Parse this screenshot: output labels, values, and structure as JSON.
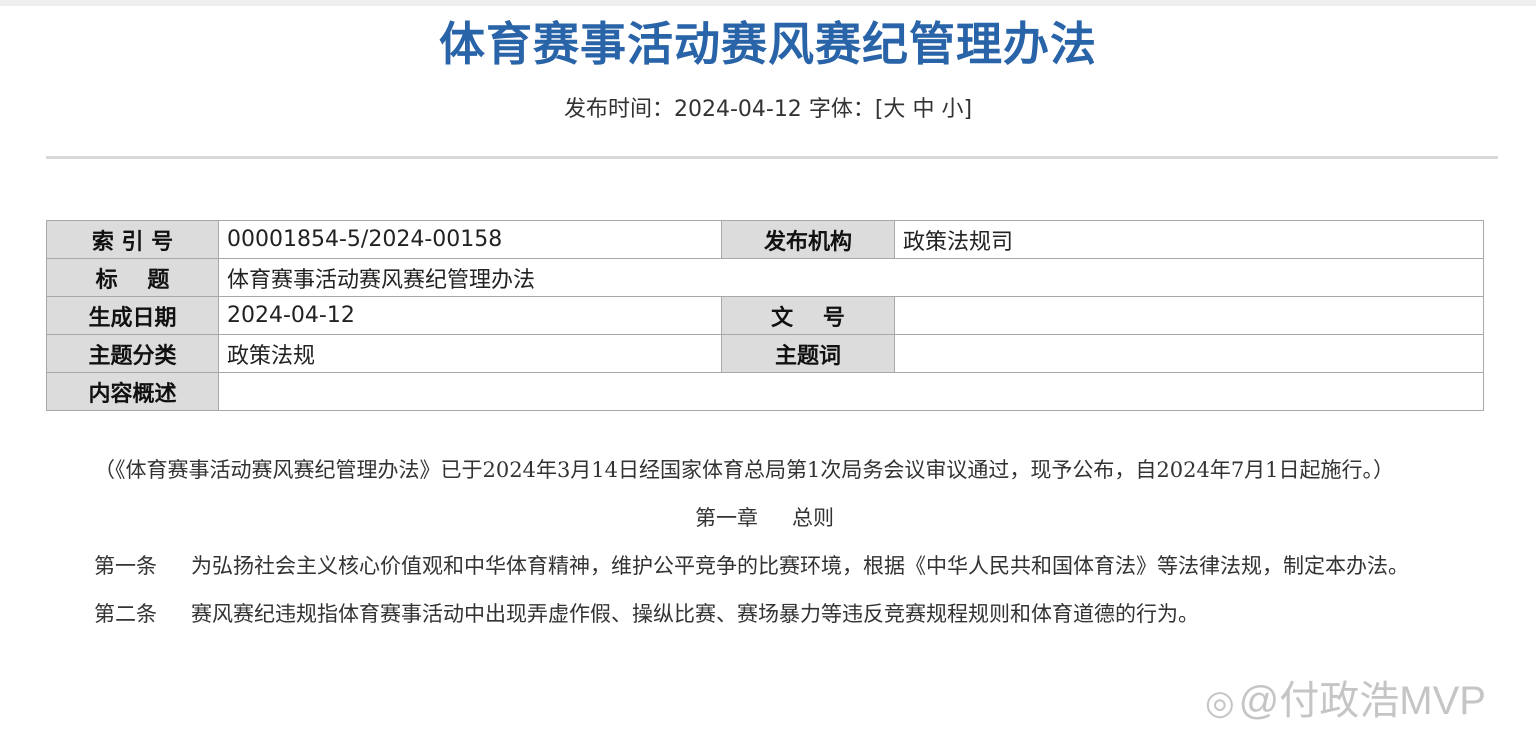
{
  "page": {
    "title": "体育赛事活动赛风赛纪管理办法",
    "publish_label": "发布时间：",
    "publish_date": "2024-04-12",
    "font_label": "字体：",
    "font_sizes": {
      "open": "[",
      "large": "大",
      "medium": "中",
      "small": "小",
      "close": "]"
    }
  },
  "info_table": {
    "index_label": "索 引 号",
    "index_value": "00001854-5/2024-00158",
    "org_label": "发布机构",
    "org_value": "政策法规司",
    "title_label": "标　 题",
    "title_value": "体育赛事活动赛风赛纪管理办法",
    "date_label": "生成日期",
    "date_value": "2024-04-12",
    "doc_no_label": "文　 号",
    "doc_no_value": "",
    "category_label": "主题分类",
    "category_value": "政策法规",
    "keywords_label": "主题词",
    "keywords_value": "",
    "summary_label": "内容概述",
    "summary_value": ""
  },
  "body": {
    "intro": "（《体育赛事活动赛风赛纪管理办法》已于2024年3月14日经国家体育总局第1次局务会议审议通过，现予公布，自2024年7月1日起施行。）",
    "chapter_no": "第一章",
    "chapter_title": "总则",
    "article1_no": "第一条",
    "article1_text": "为弘扬社会主义核心价值观和中华体育精神，维护公平竞争的比赛环境，根据《中华人民共和国体育法》等法律法规，制定本办法。",
    "article2_no": "第二条",
    "article2_text": "赛风赛纪违规指体育赛事活动中出现弄虚作假、操纵比赛、赛场暴力等违反竞赛规程规则和体育道德的行为。"
  },
  "watermark": {
    "logo": "◎",
    "text": "@付政浩MVP"
  }
}
